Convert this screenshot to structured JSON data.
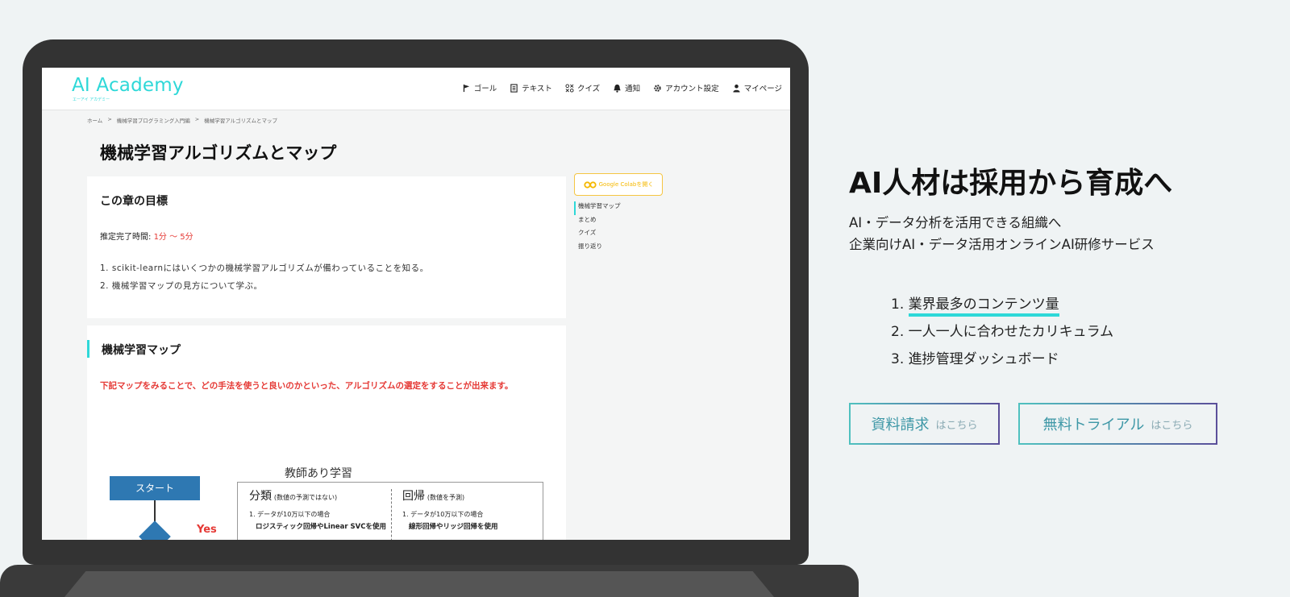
{
  "app": {
    "logo": "AI Academy",
    "logo_sub": "エーアイ アカデミー",
    "nav": [
      {
        "label": "ゴール",
        "icon": "flag-icon"
      },
      {
        "label": "テキスト",
        "icon": "document-icon"
      },
      {
        "label": "クイズ",
        "icon": "quiz-icon"
      },
      {
        "label": "通知",
        "icon": "bell-icon"
      },
      {
        "label": "アカウント設定",
        "icon": "gear-icon"
      },
      {
        "label": "マイページ",
        "icon": "user-icon"
      }
    ],
    "breadcrumb": [
      "ホーム",
      ">",
      "機械学習プログラミング入門編",
      ">",
      "機械学習アルゴリズムとマップ"
    ],
    "page_title": "機械学習アルゴリズムとマップ",
    "goal_card": {
      "heading": "この章の目標",
      "time_label": "推定完了時間: ",
      "time_value": "1分 〜 5分",
      "goals": [
        "1.  scikit-learnにはいくつかの機械学習アルゴリズムが備わっていることを知る。",
        "2.  機械学習マップの見方について学ぶ。"
      ]
    },
    "map_card": {
      "heading": "機械学習マップ",
      "note": "下記マップをみることで、どの手法を使うと良いのかといった、アルゴリズムの選定をすることが出来ます。",
      "flow_title": "教師あり学習",
      "start": "スタート",
      "yes": "Yes",
      "classification": {
        "title": "分類",
        "sub": "(数値の予測ではない)",
        "line1": "1. データが10万以下の場合",
        "line2": "ロジスティック回帰やLinear SVCを使用"
      },
      "regression": {
        "title": "回帰",
        "sub": "(数値を予測)",
        "line1": "1. データが10万以下の場合",
        "line2": "線形回帰やリッジ回帰を使用"
      }
    },
    "colab_button": "Google Colabを開く",
    "toc": [
      "機械学習マップ",
      "まとめ",
      "クイズ",
      "振り返り"
    ]
  },
  "hero": {
    "title": "AI人材は採用から育成へ",
    "sub1": "AI・データ分析を活用できる組織へ",
    "sub2": "企業向けAI・データ活用オンラインAI研修サービス",
    "features": [
      {
        "num": "1. ",
        "text": "業界最多のコンテンツ量"
      },
      {
        "num": "2. ",
        "text": "一人一人に合わせたカリキュラム"
      },
      {
        "num": "3. ",
        "text": "進捗管理ダッシュボード"
      }
    ],
    "buttons": [
      {
        "label": "資料請求",
        "small": "はこちら"
      },
      {
        "label": "無料トライアル",
        "small": "はこちら"
      }
    ],
    "accent_color": "#2ed8d8"
  }
}
